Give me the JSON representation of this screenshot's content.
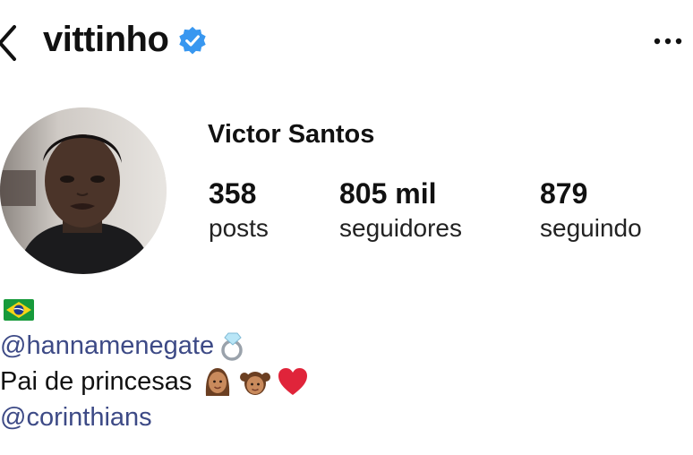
{
  "header": {
    "username": "vittinho",
    "verified": true,
    "back_icon": "chevron-left-icon",
    "more_icon": "more-horizontal-icon"
  },
  "profile": {
    "full_name": "Victor Santos",
    "stats": [
      {
        "value": "358",
        "label": "posts"
      },
      {
        "value": "805 mil",
        "label": "seguidores"
      },
      {
        "value": "879",
        "label": "seguindo"
      }
    ]
  },
  "bio": {
    "flag_icon": "brazil-flag-icon",
    "mention_1": "@hannamenegate",
    "ring_icon": "ring-icon",
    "line_text": "Pai de princesas",
    "emojis": [
      "woman-icon",
      "girl-icon",
      "red-heart-icon"
    ],
    "mention_2": "@corinthians"
  },
  "colors": {
    "link": "#3d4a86",
    "verified": "#3897f0",
    "heart": "#e0243a"
  }
}
